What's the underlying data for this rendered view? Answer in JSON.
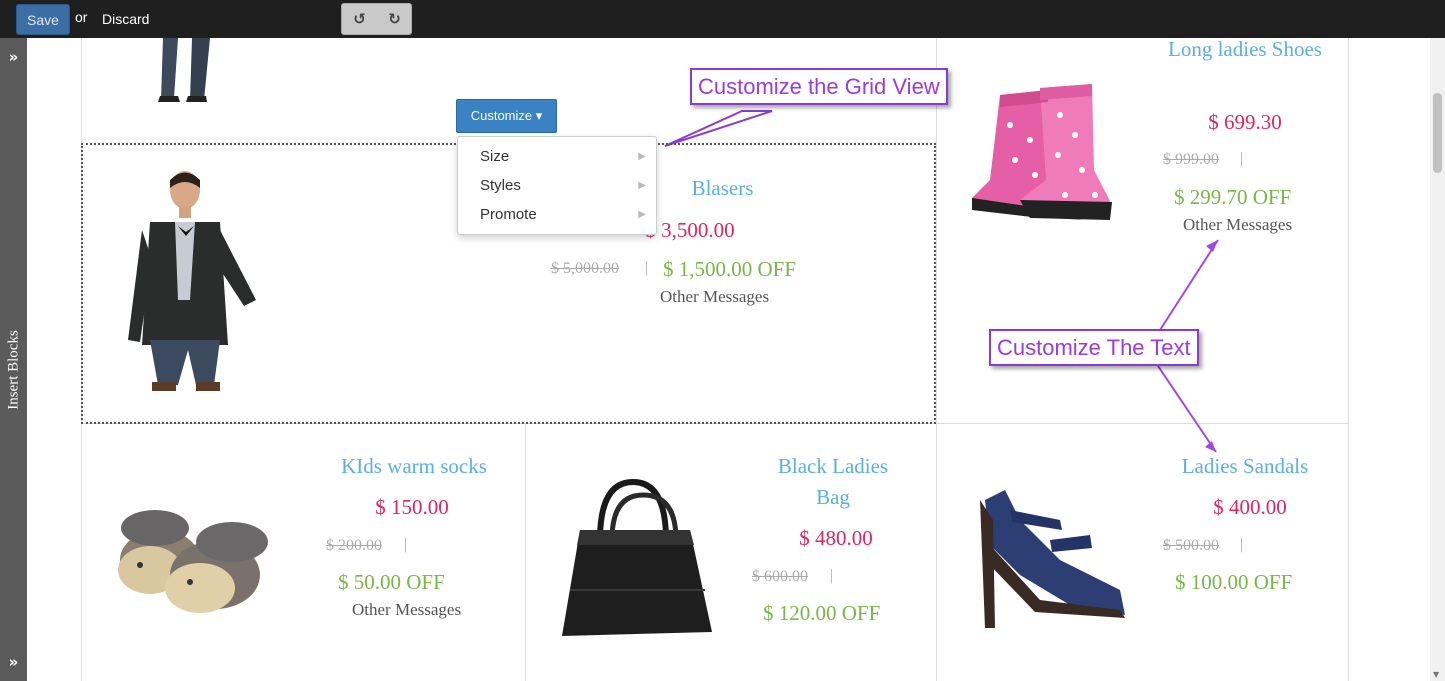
{
  "toolbar": {
    "save_label": "Save",
    "or_label": "or",
    "discard_label": "Discard",
    "undo_icon": "↺",
    "redo_icon": "↻"
  },
  "sidebar": {
    "label": "Insert Blocks",
    "expand_icon": "»"
  },
  "customize_menu": {
    "button_label": "Customize ▾",
    "items": [
      {
        "label": "Size"
      },
      {
        "label": "Styles"
      },
      {
        "label": "Promote"
      }
    ],
    "caret_icon": "▶"
  },
  "callouts": {
    "grid": "Customize the Grid View",
    "text": "Customize The Text"
  },
  "products": {
    "long_shoes": {
      "title": "Long ladies Shoes",
      "price": "$ 699.30",
      "old_price": "$ 999.00",
      "off": "$ 299.70 OFF",
      "message": "Other Messages"
    },
    "blasers": {
      "title": "Blasers",
      "price": "$ 3,500.00",
      "old_price": "$ 5,000.00",
      "off": "$ 1,500.00 OFF",
      "message": "Other Messages"
    },
    "socks": {
      "title": "KIds warm socks",
      "price": "$ 150.00",
      "old_price": "$ 200.00",
      "off": "$ 50.00 OFF",
      "message": "Other Messages"
    },
    "bag": {
      "title": "Black Ladies Bag",
      "price": "$ 480.00",
      "old_price": "$ 600.00",
      "off": "$ 120.00 OFF"
    },
    "sandals": {
      "title": "Ladies Sandals",
      "price": "$ 400.00",
      "old_price": "$ 500.00",
      "off": "$ 100.00 OFF"
    }
  },
  "separator": "|",
  "colors": {
    "title": "#5aaee3",
    "price": "#e0245e",
    "off": "#7ab648",
    "callout": "#9a3bdc",
    "primary_button": "#3b82c4"
  }
}
